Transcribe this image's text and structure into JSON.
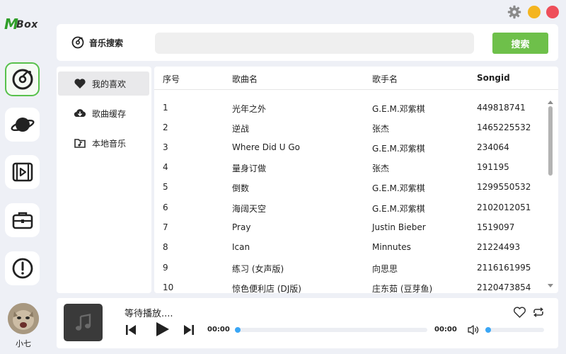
{
  "app": {
    "logo_m": "M",
    "logo_box": "Box"
  },
  "rail": {
    "icons": [
      "music-disc-icon",
      "planet-icon",
      "video-icon",
      "briefcase-icon",
      "alert-icon"
    ],
    "user_name": "小七"
  },
  "header": {
    "section_title": "音乐搜索",
    "search_placeholder": "",
    "search_button": "搜索"
  },
  "side_menu": {
    "items": [
      {
        "label": "我的喜欢",
        "icon": "heart-icon",
        "active": true
      },
      {
        "label": "歌曲缓存",
        "icon": "cloud-download-icon",
        "active": false
      },
      {
        "label": "本地音乐",
        "icon": "music-folder-icon",
        "active": false
      }
    ]
  },
  "table": {
    "columns": [
      "序号",
      "歌曲名",
      "歌手名",
      "Songid"
    ],
    "rows": [
      [
        "1",
        "光年之外",
        "G.E.M.邓紫棋",
        "449818741"
      ],
      [
        "2",
        "逆战",
        "张杰",
        "1465225532"
      ],
      [
        "3",
        "Where Did U Go",
        "G.E.M.邓紫棋",
        "234064"
      ],
      [
        "4",
        "量身订做",
        "张杰",
        "191195"
      ],
      [
        "5",
        "倒数",
        "G.E.M.邓紫棋",
        "1299550532"
      ],
      [
        "6",
        "海阔天空",
        "G.E.M.邓紫棋",
        "2102012051"
      ],
      [
        "7",
        "Pray",
        "Justin Bieber",
        "1519097"
      ],
      [
        "8",
        "Ican",
        "Minnutes",
        "21224493"
      ],
      [
        "9",
        "练习 (女声版)",
        "向思思",
        "2116161995"
      ],
      [
        "10",
        "惊色便利店 (DJ版)",
        "庄东茹 (豆芽鱼)",
        "2120473854"
      ]
    ]
  },
  "player": {
    "now_playing": "等待播放....",
    "current_time": "00:00",
    "total_time": "00:00",
    "progress": 0,
    "volume": 0
  },
  "colors": {
    "accent_green": "#6ec04a",
    "progress_blue": "#3aa6f5",
    "close_red": "#ee4e5a",
    "min_yellow": "#f4b520"
  }
}
